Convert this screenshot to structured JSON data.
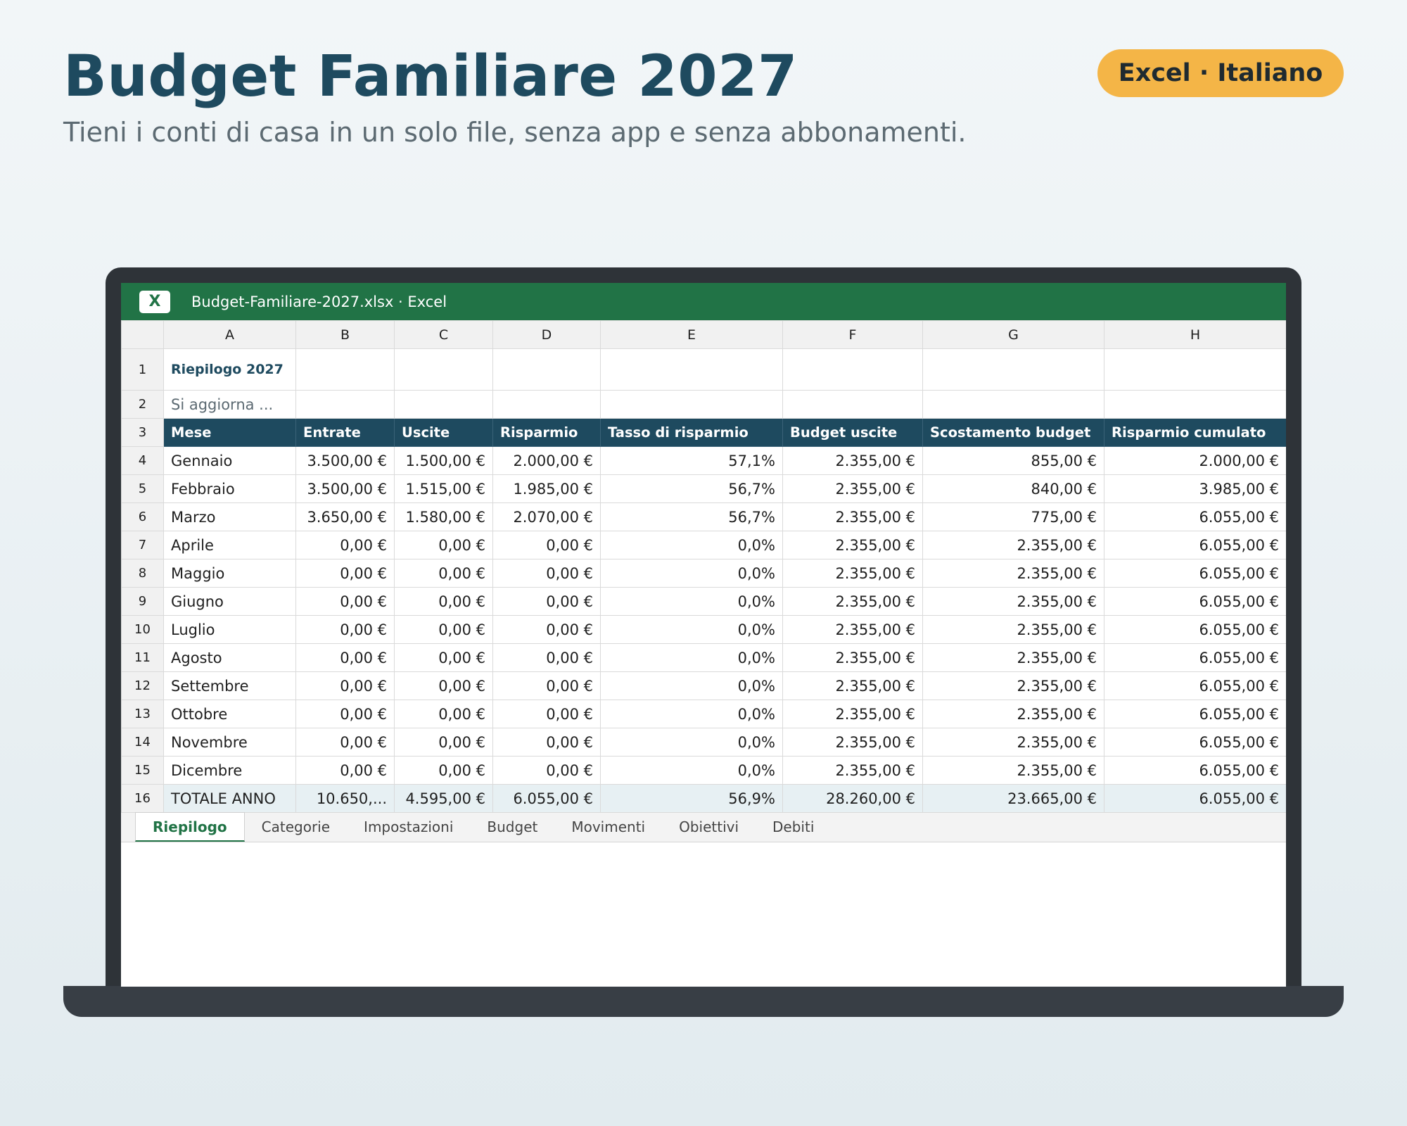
{
  "hero": {
    "title": "Budget Familiare 2027",
    "subtitle": "Tieni i conti di casa in un solo file, senza app e senza abbonamenti.",
    "badge": "Excel · Italiano"
  },
  "window": {
    "logo": "X",
    "title": "Budget-Familiare-2027.xlsx · Excel"
  },
  "sheet": {
    "column_letters": [
      "A",
      "B",
      "C",
      "D",
      "E",
      "F",
      "G",
      "H"
    ],
    "row_numbers": [
      "1",
      "2",
      "3",
      "4",
      "5",
      "6",
      "7",
      "8",
      "9",
      "10",
      "11",
      "12",
      "13",
      "14",
      "15",
      "16"
    ],
    "title_cell": "Riepilogo 2027",
    "note_cell": "Si aggiorna ...",
    "headers": [
      "Mese",
      "Entrate",
      "Uscite",
      "Risparmio",
      "Tasso di risparmio",
      "Budget uscite",
      "Scostamento budget",
      "Risparmio cumulato"
    ],
    "rows": [
      [
        "Gennaio",
        "3.500,00 €",
        "1.500,00 €",
        "2.000,00 €",
        "57,1%",
        "2.355,00 €",
        "855,00 €",
        "2.000,00 €"
      ],
      [
        "Febbraio",
        "3.500,00 €",
        "1.515,00 €",
        "1.985,00 €",
        "56,7%",
        "2.355,00 €",
        "840,00 €",
        "3.985,00 €"
      ],
      [
        "Marzo",
        "3.650,00 €",
        "1.580,00 €",
        "2.070,00 €",
        "56,7%",
        "2.355,00 €",
        "775,00 €",
        "6.055,00 €"
      ],
      [
        "Aprile",
        "0,00 €",
        "0,00 €",
        "0,00 €",
        "0,0%",
        "2.355,00 €",
        "2.355,00 €",
        "6.055,00 €"
      ],
      [
        "Maggio",
        "0,00 €",
        "0,00 €",
        "0,00 €",
        "0,0%",
        "2.355,00 €",
        "2.355,00 €",
        "6.055,00 €"
      ],
      [
        "Giugno",
        "0,00 €",
        "0,00 €",
        "0,00 €",
        "0,0%",
        "2.355,00 €",
        "2.355,00 €",
        "6.055,00 €"
      ],
      [
        "Luglio",
        "0,00 €",
        "0,00 €",
        "0,00 €",
        "0,0%",
        "2.355,00 €",
        "2.355,00 €",
        "6.055,00 €"
      ],
      [
        "Agosto",
        "0,00 €",
        "0,00 €",
        "0,00 €",
        "0,0%",
        "2.355,00 €",
        "2.355,00 €",
        "6.055,00 €"
      ],
      [
        "Settembre",
        "0,00 €",
        "0,00 €",
        "0,00 €",
        "0,0%",
        "2.355,00 €",
        "2.355,00 €",
        "6.055,00 €"
      ],
      [
        "Ottobre",
        "0,00 €",
        "0,00 €",
        "0,00 €",
        "0,0%",
        "2.355,00 €",
        "2.355,00 €",
        "6.055,00 €"
      ],
      [
        "Novembre",
        "0,00 €",
        "0,00 €",
        "0,00 €",
        "0,0%",
        "2.355,00 €",
        "2.355,00 €",
        "6.055,00 €"
      ],
      [
        "Dicembre",
        "0,00 €",
        "0,00 €",
        "0,00 €",
        "0,0%",
        "2.355,00 €",
        "2.355,00 €",
        "6.055,00 €"
      ]
    ],
    "total_row": [
      "TOTALE ANNO",
      "10.650,...",
      "4.595,00 €",
      "6.055,00 €",
      "56,9%",
      "28.260,00 €",
      "23.665,00 €",
      "6.055,00 €"
    ]
  },
  "tabs": [
    {
      "label": "Riepilogo",
      "active": true
    },
    {
      "label": "Categorie",
      "active": false
    },
    {
      "label": "Impostazioni",
      "active": false
    },
    {
      "label": "Budget",
      "active": false
    },
    {
      "label": "Movimenti",
      "active": false
    },
    {
      "label": "Obiettivi",
      "active": false
    },
    {
      "label": "Debiti",
      "active": false
    }
  ]
}
